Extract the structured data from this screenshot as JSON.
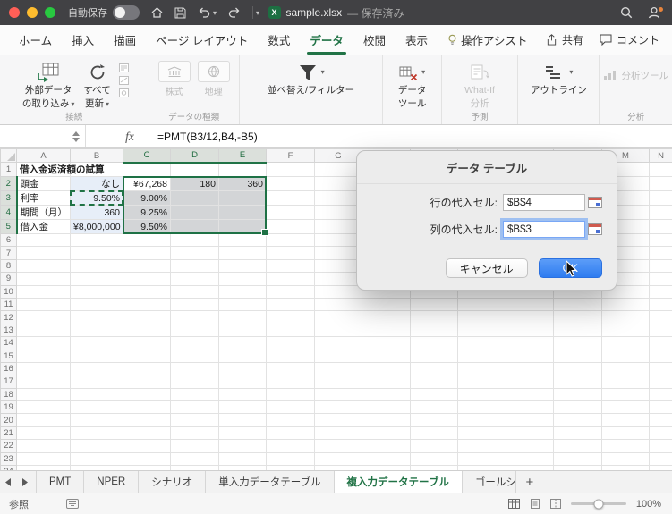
{
  "titlebar": {
    "autosave_label": "自動保存",
    "autosave_on": false,
    "app_icon_letter": "X",
    "doc_name": "sample.xlsx",
    "doc_status": "— 保存済み"
  },
  "ribbon_tabs": {
    "items": [
      "ホーム",
      "挿入",
      "描画",
      "ページ レイアウト",
      "数式",
      "データ",
      "校閲",
      "表示",
      "操作アシスト"
    ],
    "active": "データ",
    "share_label": "共有",
    "comments_label": "コメント"
  },
  "ribbon": {
    "get_external_line1": "外部データ",
    "get_external_line2": "の取り込み",
    "refresh_line1": "すべて",
    "refresh_line2": "更新",
    "group_connections": "接続",
    "stocks": "株式",
    "geography": "地理",
    "group_data_types": "データの種類",
    "sort_filter": "並べ替え/フィルター",
    "data_tools_line1": "データ",
    "data_tools_line2": "ツール",
    "whatif_line1": "What-If",
    "whatif_line2": "分析",
    "group_forecast": "予測",
    "outline": "アウトライン",
    "analysis_tools": "分析ツール",
    "group_analysis": "分析"
  },
  "formula_bar": {
    "fx_label": "fx",
    "formula": "=PMT(B3/12,B4,-B5)"
  },
  "grid": {
    "columns": [
      "A",
      "B",
      "C",
      "D",
      "E",
      "F",
      "G",
      "H",
      "I",
      "J",
      "K",
      "L",
      "M",
      "N"
    ],
    "row_count": 24,
    "selection": {
      "range": "C2:E5",
      "active": "C2"
    },
    "ants_cell": "B3",
    "cells": [
      {
        "ref": "A1",
        "text": "借入金返済額の試算",
        "cls": "bold overflow"
      },
      {
        "ref": "A2",
        "text": "頭金",
        "cls": ""
      },
      {
        "ref": "B2",
        "text": "なし",
        "cls": "right input"
      },
      {
        "ref": "C2",
        "text": "¥67,268",
        "cls": "right"
      },
      {
        "ref": "D2",
        "text": "180",
        "cls": "right"
      },
      {
        "ref": "E2",
        "text": "360",
        "cls": "right"
      },
      {
        "ref": "A3",
        "text": "利率",
        "cls": ""
      },
      {
        "ref": "B3",
        "text": "9.50%",
        "cls": "right input"
      },
      {
        "ref": "C3",
        "text": "9.00%",
        "cls": "right"
      },
      {
        "ref": "A4",
        "text": "期間（月）",
        "cls": ""
      },
      {
        "ref": "B4",
        "text": "360",
        "cls": "right input"
      },
      {
        "ref": "C4",
        "text": "9.25%",
        "cls": "right"
      },
      {
        "ref": "A5",
        "text": "借入金",
        "cls": ""
      },
      {
        "ref": "B5",
        "text": "¥8,000,000",
        "cls": "right input"
      },
      {
        "ref": "C5",
        "text": "9.50%",
        "cls": "right"
      }
    ]
  },
  "dialog": {
    "title": "データ テーブル",
    "fields": [
      {
        "label": "行の代入セル:",
        "value": "$B$4"
      },
      {
        "label": "列の代入セル:",
        "value": "$B$3"
      }
    ],
    "focused_field": 1,
    "cancel_label": "キャンセル",
    "ok_label": "OK"
  },
  "sheet_bar": {
    "tabs": [
      "PMT",
      "NPER",
      "シナリオ",
      "単入力データテーブル",
      "複入力データテーブル",
      "ゴールシ"
    ],
    "active": "複入力データテーブル",
    "add_label": "+"
  },
  "status_bar": {
    "mode": "参照",
    "zoom": "100%"
  },
  "colors": {
    "excel_green": "#217346",
    "selection_border": "#1e7145",
    "ok_blue": "#2f7cf0",
    "input_cell_fill": "#e7eef8"
  }
}
